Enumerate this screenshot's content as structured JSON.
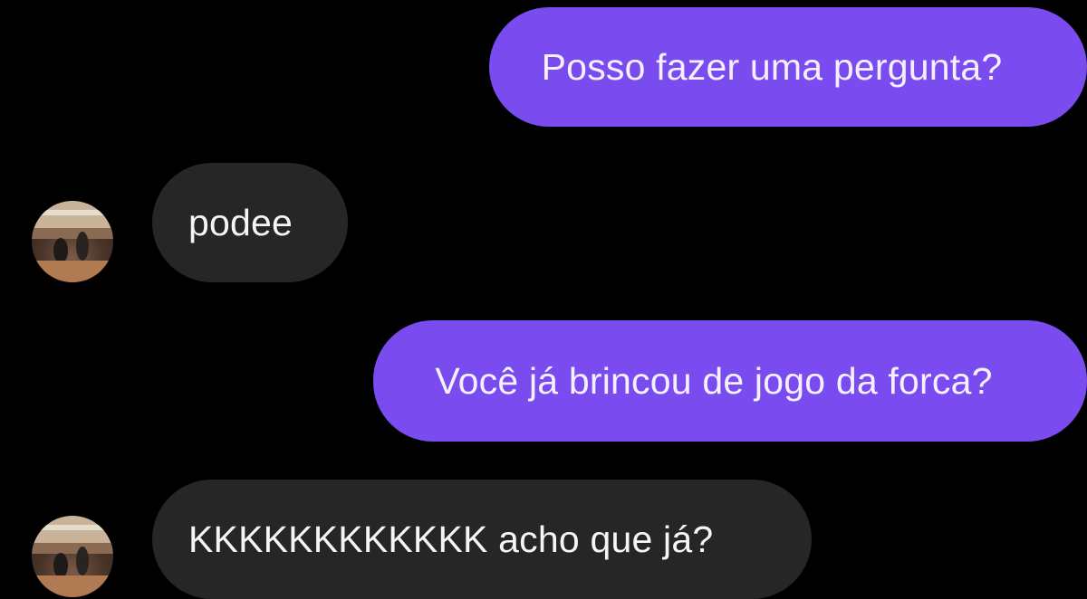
{
  "conversation": {
    "messages": [
      {
        "direction": "sent",
        "text": "Posso fazer uma pergunta?"
      },
      {
        "direction": "received",
        "text": "podee"
      },
      {
        "direction": "sent",
        "text": "Você já brincou de jogo da forca?"
      },
      {
        "direction": "received",
        "text": "KKKKKKKKKKKK acho que já?"
      }
    ]
  },
  "colors": {
    "background": "#000000",
    "sent_bubble": "#7a4cf0",
    "received_bubble": "#262626",
    "text": "#f5f5f5"
  },
  "icons": {
    "contact_avatar": "avatar-photo"
  }
}
